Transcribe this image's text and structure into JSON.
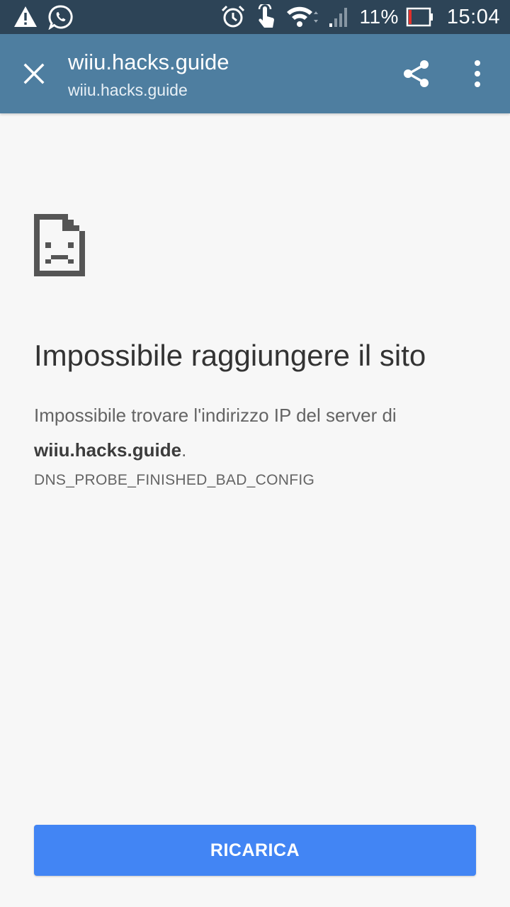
{
  "status_bar": {
    "battery_percent": "11%",
    "battery_level": 0.11,
    "time": "15:04",
    "left_icons": [
      "warning-icon",
      "whatsapp-icon"
    ],
    "right_icons": [
      "alarm-icon",
      "touch-icon",
      "wifi-icon",
      "cellular-signal-icon",
      "battery-icon"
    ]
  },
  "toolbar": {
    "title": "wiiu.hacks.guide",
    "url": "wiiu.hacks.guide",
    "close_icon": "close-icon",
    "share_icon": "share-icon",
    "menu_icon": "more-vert-icon"
  },
  "error": {
    "icon": "sad-page-icon",
    "heading": "Impossibile raggiungere il sito",
    "description_prefix": "Impossibile trovare l'indirizzo IP del server di",
    "host": "wiiu.hacks.guide",
    "description_suffix": ".",
    "code": "DNS_PROBE_FINISHED_BAD_CONFIG"
  },
  "reload_button": {
    "label": "RICARICA"
  },
  "colors": {
    "status_bar": "#2d4457",
    "toolbar": "#4e7ea0",
    "background": "#f7f7f7",
    "button": "#4285f4"
  }
}
